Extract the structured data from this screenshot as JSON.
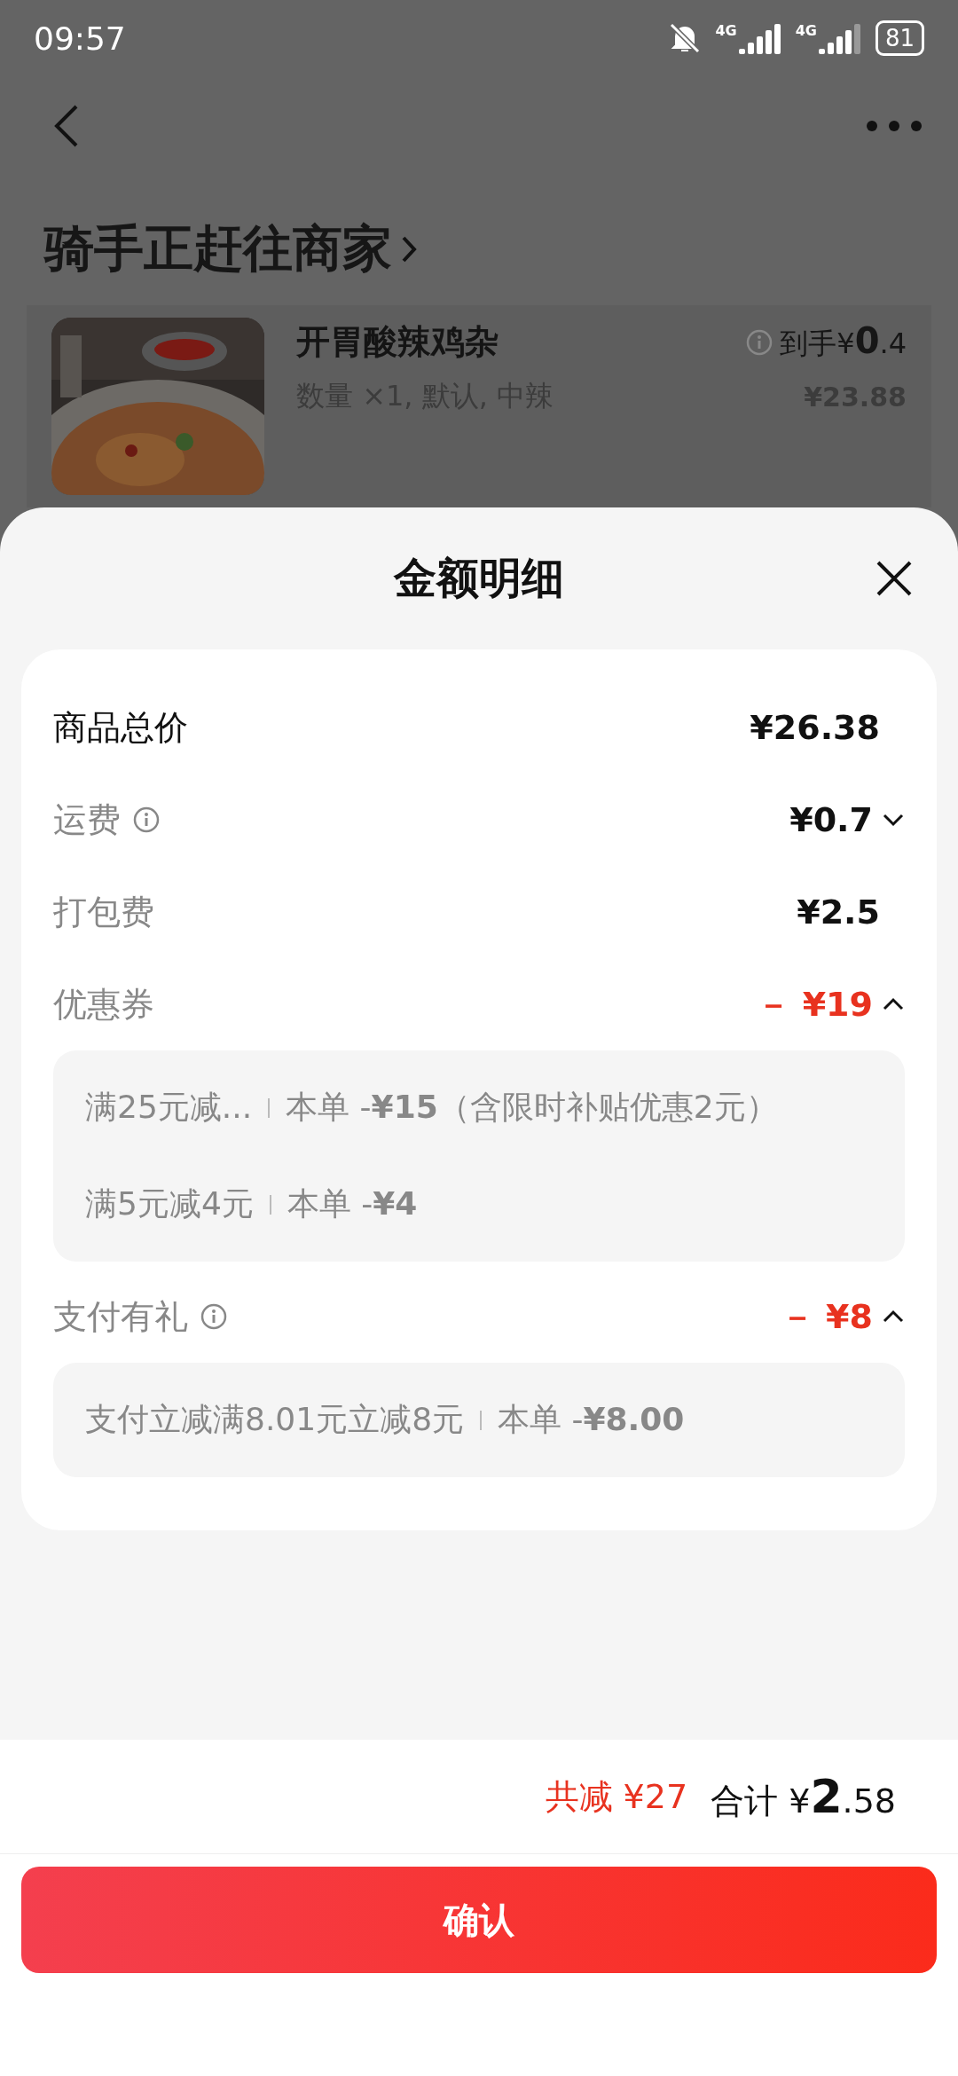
{
  "status_bar": {
    "time": "09:57",
    "networks": [
      "4G",
      "4G"
    ],
    "battery": "81"
  },
  "header": {
    "title": "骑手正赶往商家"
  },
  "product": {
    "kind": "picture",
    "name": "开胃酸辣鸡杂",
    "options": "数量 ×1, 默认, 中辣",
    "net_price": "到手¥**0**.4",
    "price": "¥23.88"
  },
  "sheet": {
    "title": "金额明细",
    "rows": [
      {
        "kind": "plain",
        "label": "商品总价",
        "emphasis": true,
        "info": false,
        "value": "¥26.38",
        "discount": false
      },
      {
        "kind": "toggle",
        "label": "运费",
        "emphasis": false,
        "info": true,
        "value": "¥0.7",
        "discount": false,
        "expanded": false
      },
      {
        "kind": "plain",
        "label": "打包费",
        "emphasis": false,
        "info": false,
        "value": "¥2.5",
        "discount": false
      },
      {
        "kind": "toggle",
        "label": "优惠券",
        "emphasis": false,
        "info": false,
        "value": "－ ¥19",
        "discount": true,
        "expanded": true,
        "details": [
          {
            "name": "满25元减...",
            "amount": "本单 -**¥15**（含限时补贴优惠2元）"
          },
          {
            "name": "满5元减4元",
            "amount": "本单 -**¥4**"
          }
        ]
      },
      {
        "kind": "toggle",
        "label": "支付有礼",
        "emphasis": false,
        "info": true,
        "value": "－ ¥8",
        "discount": true,
        "expanded": true,
        "details": [
          {
            "name": "支付立减满8.01元立减8元",
            "amount": "本单 -**¥8.00**"
          }
        ]
      }
    ],
    "saved": "共减 ¥27",
    "total": "合计 ¥**2**.58",
    "confirm": "确认"
  }
}
